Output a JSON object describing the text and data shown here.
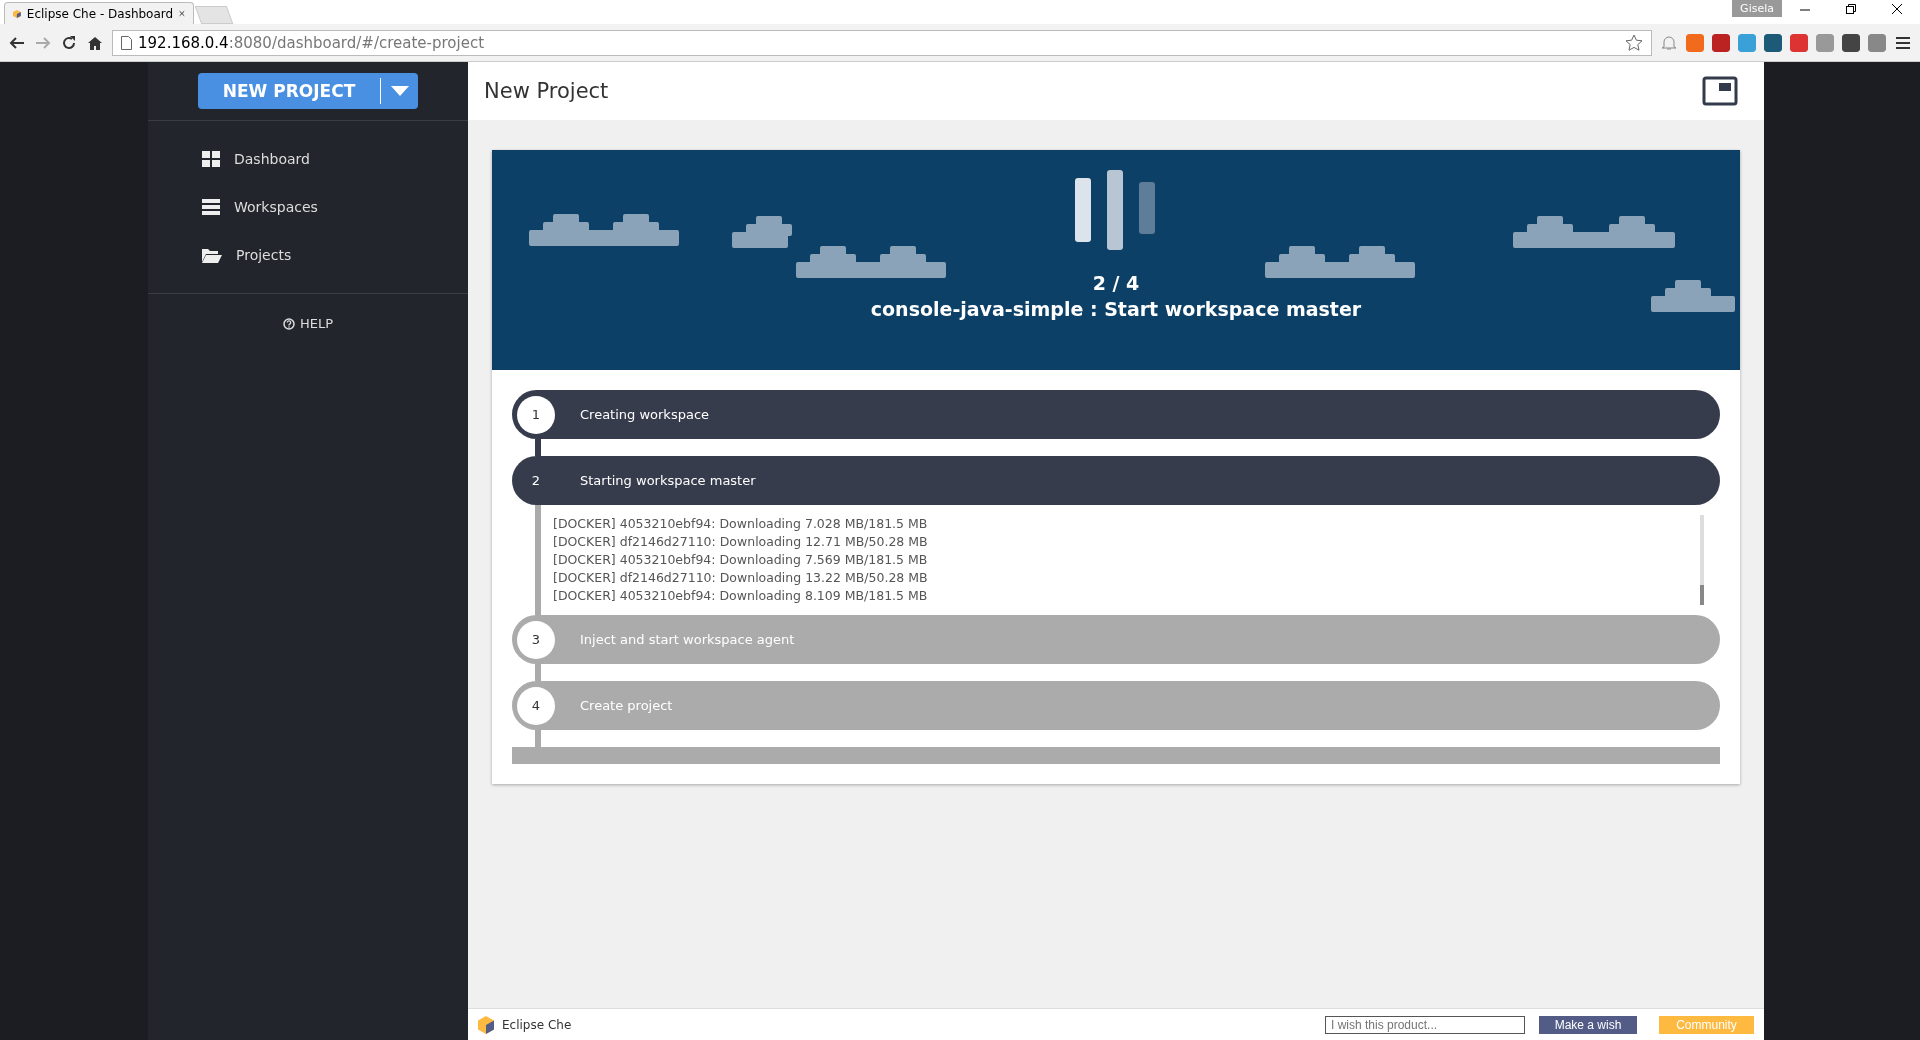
{
  "browser": {
    "tab_title": "Eclipse Che - Dashboard",
    "url_host": "192.168.0.4",
    "url_path": ":8080/dashboard/#/create-project",
    "user": "Gisela"
  },
  "sidebar": {
    "new_project_button": "NEW PROJECT",
    "items": [
      {
        "label": "Dashboard",
        "selected": false
      },
      {
        "label": "Workspaces",
        "selected": false
      },
      {
        "label": "Projects",
        "selected": false
      }
    ],
    "help": "HELP"
  },
  "header": {
    "title": "New Project"
  },
  "progress": {
    "counter": "2 / 4",
    "message": "console-java-simple : Start workspace master",
    "steps": [
      {
        "number": "1",
        "label": "Creating workspace",
        "kind": "done"
      },
      {
        "number": "2",
        "label": "Starting workspace master",
        "kind": "active",
        "log": [
          "[DOCKER] 4053210ebf94: Downloading 7.028 MB/181.5 MB",
          "[DOCKER] df2146d27110: Downloading 12.71 MB/50.28 MB",
          "[DOCKER] 4053210ebf94: Downloading 7.569 MB/181.5 MB",
          "[DOCKER] df2146d27110: Downloading 13.22 MB/50.28 MB",
          "[DOCKER] 4053210ebf94: Downloading 8.109 MB/181.5 MB"
        ]
      },
      {
        "number": "3",
        "label": "Inject and start workspace agent",
        "kind": "pending"
      },
      {
        "number": "4",
        "label": "Create project",
        "kind": "pending"
      }
    ]
  },
  "footer": {
    "brand": "Eclipse Che",
    "wish_placeholder": "I wish this product...",
    "wish_button": "Make a wish",
    "community_button": "Community"
  }
}
